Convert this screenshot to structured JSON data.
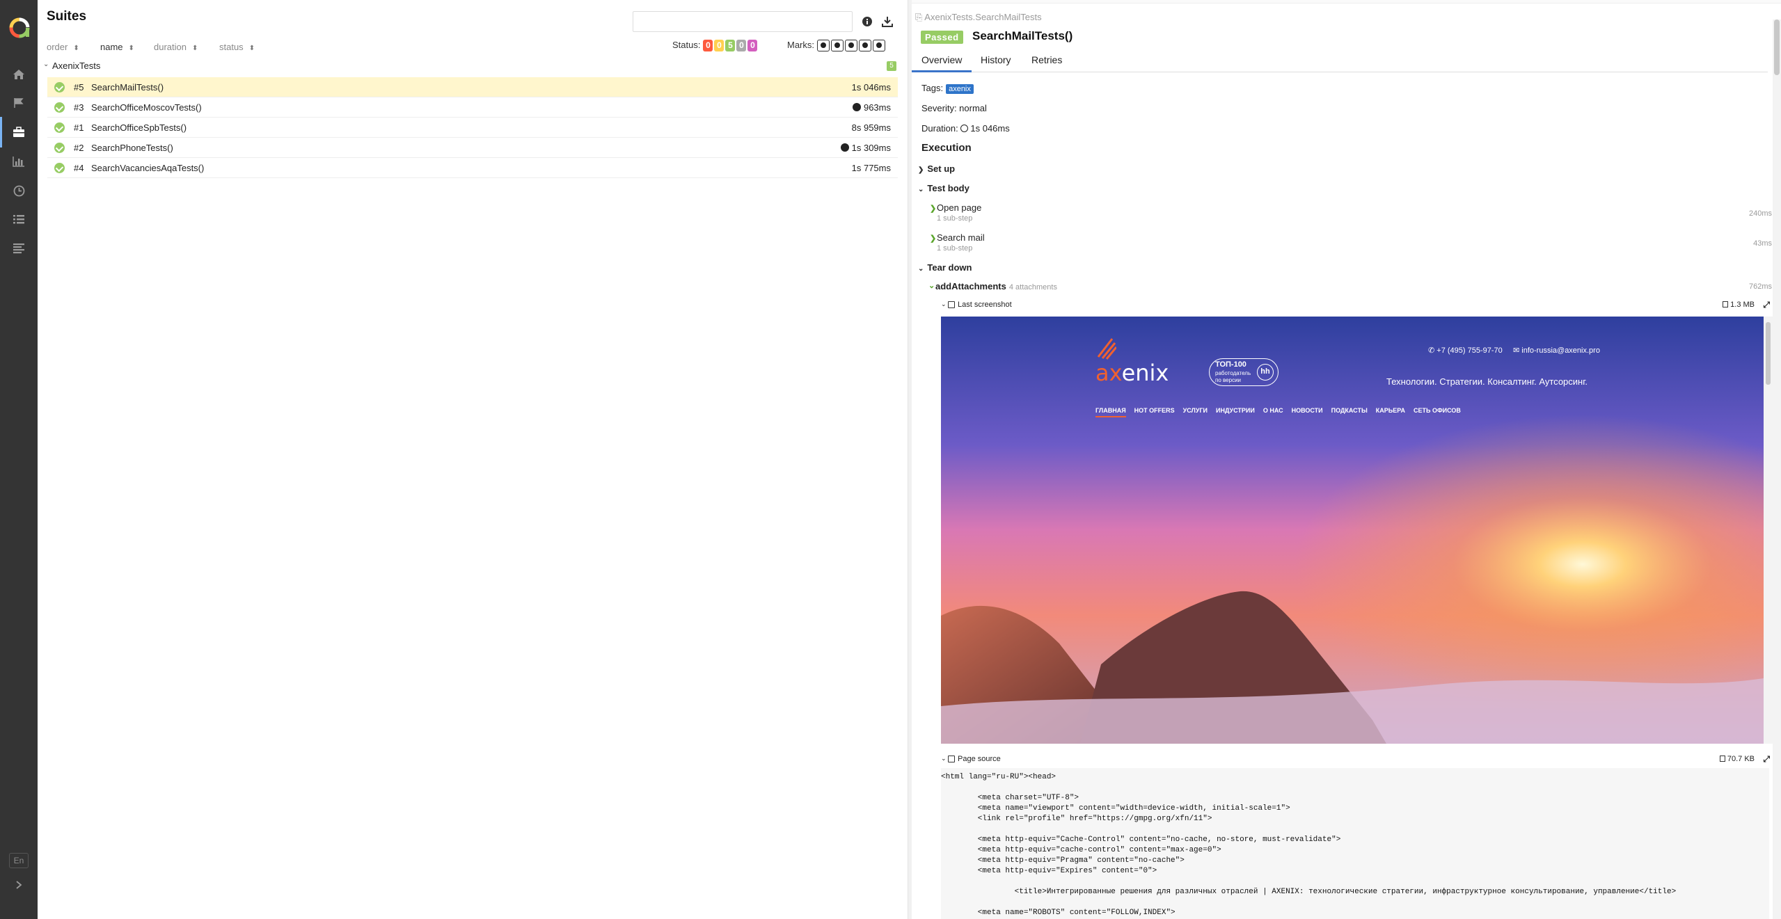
{
  "nav": {
    "lang": "En"
  },
  "left": {
    "title": "Suites",
    "sort": {
      "order": "order",
      "name": "name",
      "duration": "duration",
      "status": "status"
    },
    "status_label": "Status:",
    "status_counts": [
      {
        "value": "0",
        "color": "#fd5a3e"
      },
      {
        "value": "0",
        "color": "#ffd050"
      },
      {
        "value": "5",
        "color": "#97cc64"
      },
      {
        "value": "0",
        "color": "#aaaaaa"
      },
      {
        "value": "0",
        "color": "#d35ebe"
      }
    ],
    "marks_label": "Marks:",
    "group": {
      "name": "AxenixTests",
      "count": "5"
    },
    "rows": [
      {
        "num": "#5",
        "name": "SearchMailTests()",
        "dur": "1s 046ms",
        "flaky": false
      },
      {
        "num": "#3",
        "name": "SearchOfficeMoscovTests()",
        "dur": "963ms",
        "flaky": true
      },
      {
        "num": "#1",
        "name": "SearchOfficeSpbTests()",
        "dur": "8s 959ms",
        "flaky": false
      },
      {
        "num": "#2",
        "name": "SearchPhoneTests()",
        "dur": "1s 309ms",
        "flaky": true
      },
      {
        "num": "#4",
        "name": "SearchVacanciesAqaTests()",
        "dur": "1s 775ms",
        "flaky": false
      }
    ]
  },
  "right": {
    "breadcrumb": "AxenixTests.SearchMailTests",
    "status": "Passed",
    "test_name": "SearchMailTests()",
    "tabs": {
      "overview": "Overview",
      "history": "History",
      "retries": "Retries"
    },
    "tags_label": "Tags:",
    "tag": "axenix",
    "severity": "Severity: normal",
    "duration_label": "Duration:",
    "duration": "1s 046ms",
    "execution": "Execution",
    "setup": "Set up",
    "test_body": "Test body",
    "steps": [
      {
        "name": "Open page",
        "sub": "1 sub-step",
        "dur": "240ms"
      },
      {
        "name": "Search mail",
        "sub": "1 sub-step",
        "dur": "43ms"
      }
    ],
    "teardown": "Tear down",
    "attach": {
      "name": "addAttachments",
      "sub": "4 attachments",
      "dur": "762ms"
    },
    "screenshot": {
      "label": "Last screenshot",
      "size": "1.3 MB"
    },
    "site": {
      "phone": "+7 (495) 755-97-70",
      "email": "info-russia@axenix.pro",
      "brand_ax": "ax",
      "brand_enix": "enix",
      "top100": "ТОП-100",
      "top100_sub1": "работодатель",
      "top100_sub2": "по версии",
      "hh": "hh",
      "tagline": "Технологии. Стратегии. Консалтинг. Аутсорсинг.",
      "menu": [
        "ГЛАВНАЯ",
        "HOT OFFERS",
        "УСЛУГИ",
        "ИНДУСТРИИ",
        "О НАС",
        "НОВОСТИ",
        "ПОДКАСТЫ",
        "КАРЬЕРА",
        "СЕТЬ ОФИСОВ"
      ]
    },
    "source": {
      "label": "Page source",
      "size": "70.7 KB"
    },
    "code": [
      "<html lang=\"ru-RU\"><head>",
      "",
      "        <meta charset=\"UTF-8\">",
      "        <meta name=\"viewport\" content=\"width=device-width, initial-scale=1\">",
      "        <link rel=\"profile\" href=\"https://gmpg.org/xfn/11\">",
      "",
      "        <meta http-equiv=\"Cache-Control\" content=\"no-cache, no-store, must-revalidate\">",
      "        <meta http-equiv=\"cache-control\" content=\"max-age=0\">",
      "        <meta http-equiv=\"Pragma\" content=\"no-cache\">",
      "        <meta http-equiv=\"Expires\" content=\"0\">",
      "",
      "                <title>Интегрированные решения для различных отраслей | AXENIX: технологические стратегии, инфраструктурное консультирование, управление</title>",
      "",
      "        <meta name=\"ROBOTS\" content=\"FOLLOW,INDEX\">"
    ]
  }
}
